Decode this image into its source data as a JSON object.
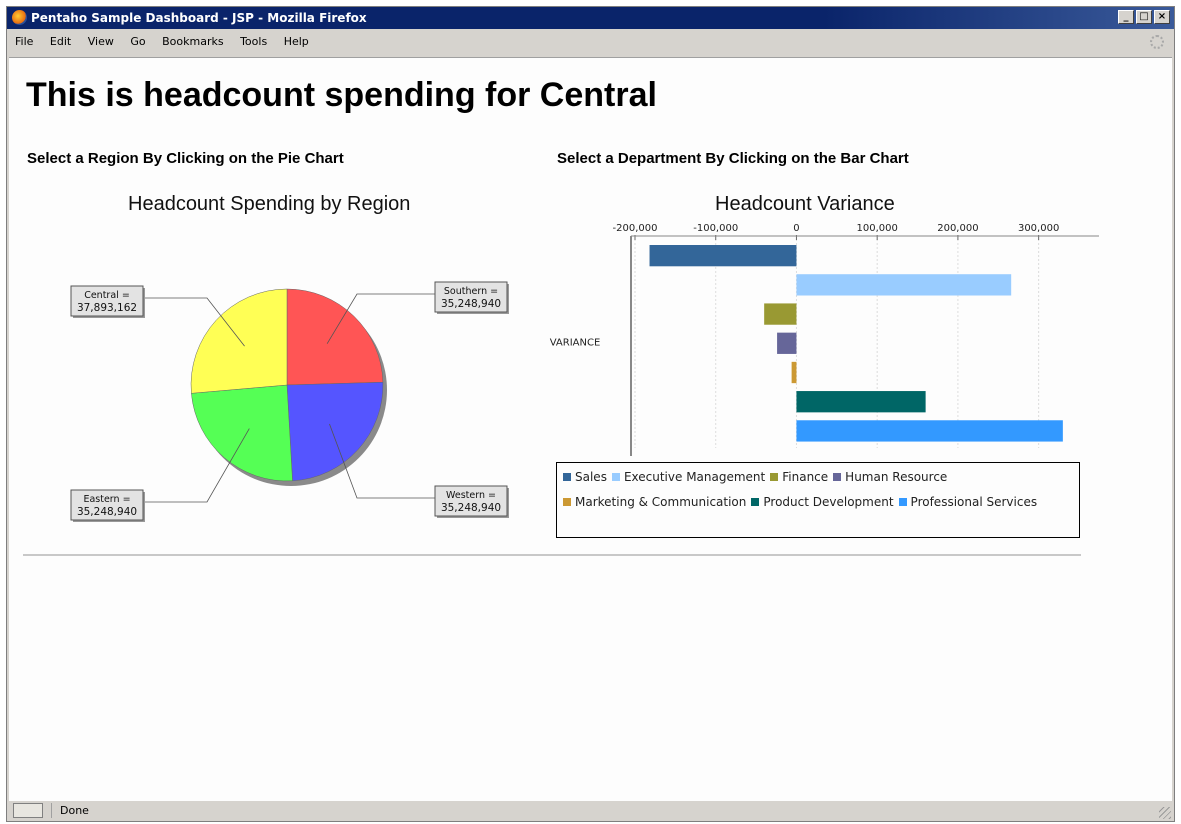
{
  "window": {
    "title": "Pentaho Sample Dashboard - JSP - Mozilla Firefox"
  },
  "menu": [
    "File",
    "Edit",
    "View",
    "Go",
    "Bookmarks",
    "Tools",
    "Help"
  ],
  "page": {
    "heading": "This is headcount spending for Central",
    "left_prompt": "Select a Region By Clicking on the Pie Chart",
    "right_prompt": "Select a Department By Clicking on the Bar Chart"
  },
  "status": {
    "text": "Done"
  },
  "chart_data": [
    {
      "type": "pie",
      "title": "Headcount Spending by Region",
      "slices": [
        {
          "label": "Southern",
          "value": 35248940,
          "display": "35,248,940",
          "color": "#ff5555"
        },
        {
          "label": "Western",
          "value": 35248940,
          "display": "35,248,940",
          "color": "#5555ff"
        },
        {
          "label": "Eastern",
          "value": 35248940,
          "display": "35,248,940",
          "color": "#55ff55"
        },
        {
          "label": "Central",
          "value": 37893162,
          "display": "37,893,162",
          "color": "#ffff55"
        }
      ]
    },
    {
      "type": "bar",
      "orientation": "horizontal",
      "title": "Headcount Variance",
      "category_label": "VARIANCE",
      "xlim": [
        -200000,
        350000
      ],
      "ticks": [
        -200000,
        -100000,
        0,
        100000,
        200000,
        300000
      ],
      "tick_labels": [
        "-200,000",
        "-100,000",
        "0",
        "100,000",
        "200,000",
        "300,000"
      ],
      "grid": true,
      "legend_position": "bottom",
      "series": [
        {
          "name": "Sales",
          "value": -182000,
          "color": "#336699"
        },
        {
          "name": "Executive Management",
          "value": 266000,
          "color": "#99ccff"
        },
        {
          "name": "Finance",
          "value": -40000,
          "color": "#999933"
        },
        {
          "name": "Human Resource",
          "value": -24000,
          "color": "#666699"
        },
        {
          "name": "Marketing & Communication",
          "value": -6000,
          "color": "#cc9933"
        },
        {
          "name": "Product Development",
          "value": 160000,
          "color": "#006666"
        },
        {
          "name": "Professional Services",
          "value": 330000,
          "color": "#3399ff"
        }
      ]
    }
  ]
}
